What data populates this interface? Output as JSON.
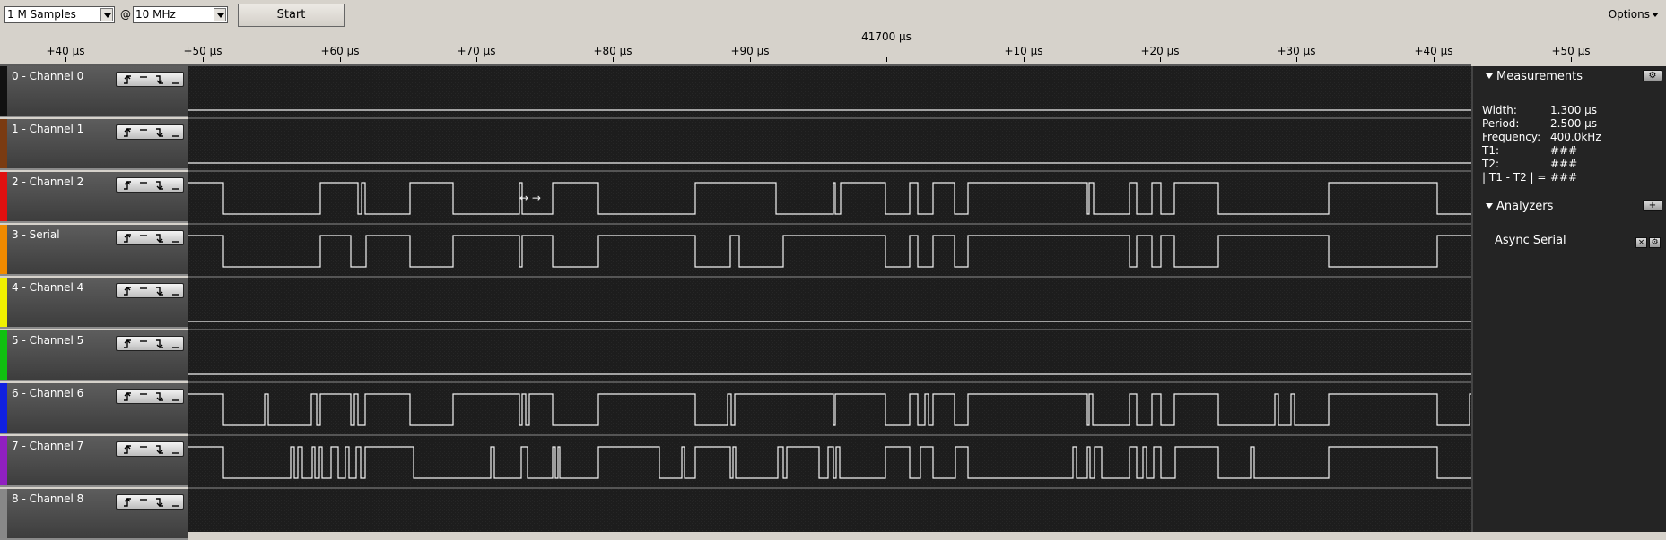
{
  "toolbar": {
    "samples": "1 M Samples",
    "at": "@",
    "rate": "10 MHz",
    "start": "Start",
    "options": "Options"
  },
  "ruler": {
    "center": "41700 µs",
    "ticks": [
      "+40 µs",
      "+50 µs",
      "+60 µs",
      "+70 µs",
      "+80 µs",
      "+90 µs",
      "",
      "+10 µs",
      "+20 µs",
      "+30 µs",
      "+40 µs",
      "+50 µs"
    ]
  },
  "channels": [
    {
      "name": "0 - Channel 0",
      "color": "#111111"
    },
    {
      "name": "1 - Channel 1",
      "color": "#7a3b12"
    },
    {
      "name": "2 - Channel 2",
      "color": "#e01010"
    },
    {
      "name": "3 - Serial",
      "color": "#f08a00"
    },
    {
      "name": "4 - Channel 4",
      "color": "#f0f000"
    },
    {
      "name": "5 - Channel 5",
      "color": "#10c010"
    },
    {
      "name": "6 - Channel 6",
      "color": "#1020e0"
    },
    {
      "name": "7 - Channel 7",
      "color": "#9020c0"
    },
    {
      "name": "8 - Channel 8",
      "color": "#888888"
    }
  ],
  "panel": {
    "measurements_title": "Measurements",
    "measurements": [
      {
        "k": "Width:",
        "v": "1.300 µs"
      },
      {
        "k": "Period:",
        "v": "2.500 µs"
      },
      {
        "k": "Frequency:",
        "v": "400.0kHz"
      },
      {
        "k": "T1:",
        "v": "###"
      },
      {
        "k": "T2:",
        "v": "###"
      },
      {
        "k": "| T1 - T2 | =",
        "v": "###"
      }
    ],
    "analyzers_title": "Analyzers",
    "analyzer_item": "Async Serial"
  }
}
